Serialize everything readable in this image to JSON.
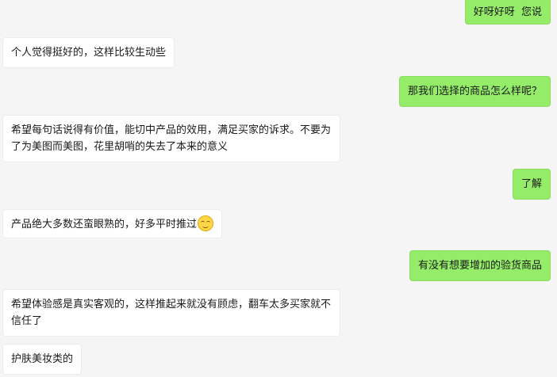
{
  "messages": [
    {
      "side": "sent",
      "text": "好呀好呀  您说"
    },
    {
      "side": "received",
      "text": "个人觉得挺好的，这样比较生动些"
    },
    {
      "side": "sent",
      "text": "那我们选择的商品怎么样呢？"
    },
    {
      "side": "received",
      "text": "希望每句话说得有价值，能切中产品的效用，满足买家的诉求。不要为了为美图而美图，花里胡哨的失去了本来的意义"
    },
    {
      "side": "sent",
      "text": "了解"
    },
    {
      "side": "received",
      "text": "产品绝大多数还蛮眼熟的，好多平时推过",
      "emoji": "smiling-face-icon"
    },
    {
      "side": "sent",
      "text": "有没有想要增加的验货商品"
    },
    {
      "side": "received",
      "text": "希望体验感是真实客观的，这样推起来就没有顾虑，翻车太多买家就不信任了"
    },
    {
      "side": "received",
      "text": "护肤美妆类的"
    }
  ],
  "colors": {
    "sent_bubble": "#95ec69",
    "received_bubble": "#ffffff",
    "background": "#f5f5f5"
  }
}
